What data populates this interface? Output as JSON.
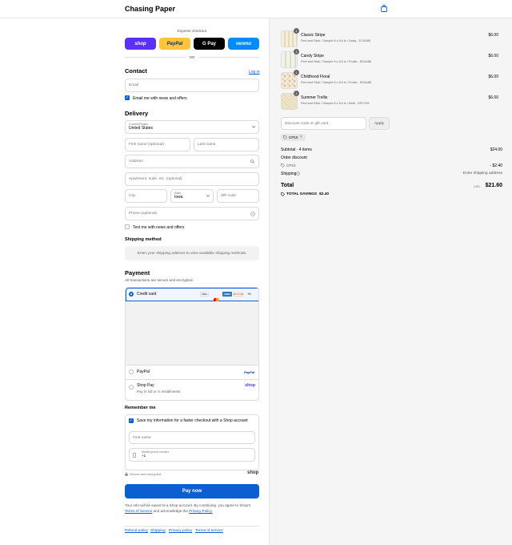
{
  "header": {
    "brand": "Chasing Paper",
    "cart_icon": "shopping-bag-icon"
  },
  "express": {
    "title": "Express checkout",
    "buttons": [
      "shop",
      "PayPal",
      "G Pay",
      "venmo"
    ],
    "colors": {
      "shop": "#5a31f4",
      "paypal": "#ffc439",
      "gpay": "#000000",
      "venmo": "#008cff"
    },
    "or": "OR"
  },
  "contact": {
    "title": "Contact",
    "login": "Log in",
    "email_placeholder": "Email",
    "news_label": "Email me with news and offers",
    "news_checked": true
  },
  "delivery": {
    "title": "Delivery",
    "country_label": "Country/Region",
    "country_value": "United States",
    "first_name": "First name (optional)",
    "last_name": "Last name",
    "address": "Address",
    "apartment": "Apartment, suite, etc. (optional)",
    "city": "City",
    "state_label": "State",
    "state_value": "Iowa",
    "zip": "ZIP code",
    "phone": "Phone (optional)",
    "text_label": "Text me with news and offers",
    "text_checked": false
  },
  "shipping": {
    "title": "Shipping method",
    "message": "Enter your shipping address to view available shipping methods."
  },
  "payment": {
    "title": "Payment",
    "subtitle": "All transactions are secure and encrypted.",
    "credit_card": "Credit card",
    "card_brands": [
      "VISA",
      "MC",
      "AMEX",
      "DISCOVER"
    ],
    "more_cards": "+5",
    "paypal": "PayPal",
    "paypal_logo": "PayPal",
    "shop_pay": "Shop Pay",
    "shop_pay_sub": "Pay in full or in installments",
    "shop_logo": "shop"
  },
  "remember": {
    "title": "Remember me",
    "save_label": "Save my information for a faster checkout with a Shop account",
    "first_name": "First name",
    "phone_label": "Mobile phone number",
    "phone_prefix": "+1",
    "secure": "Secure and encrypted",
    "shop_logo": "shop"
  },
  "pay_button": "Pay now",
  "legal": {
    "line1": "Your info will be saved to a Shop account. By continuing, you agree to Shop's",
    "tos": "Terms of Service",
    "and": "and acknowledge the",
    "privacy": "Privacy Policy."
  },
  "footer": {
    "links": [
      "Refund policy",
      "Shipping",
      "Privacy policy",
      "Terms of service"
    ]
  },
  "cart": {
    "items": [
      {
        "name": "Classic Stripe",
        "desc": "Peel and Stick / Sample 8 x 8.6 in / Daisy - ECA086",
        "price": "$6.00",
        "qty": "1"
      },
      {
        "name": "Candy Stripe",
        "desc": "Peel and Stick / Sample 8 x 8.6 in / Poolie - EDA488",
        "price": "$6.00",
        "qty": "1"
      },
      {
        "name": "Childhood Floral",
        "desc": "Peel and Stick / Sample 8 x 8.6 in / Poolie - EDA488",
        "price": "$6.00",
        "qty": "1"
      },
      {
        "name": "Summer Trellis",
        "desc": "Peel and Stick / Sample 8 x 8.6 in / Multi - EPC709",
        "price": "$6.00",
        "qty": "1"
      }
    ],
    "discount_placeholder": "Discount code or gift card",
    "apply": "Apply",
    "code_tag": "CP10",
    "subtotal_label": "Subtotal · 4 items",
    "subtotal_value": "$24.00",
    "order_discount_label": "Order discount",
    "discount_code": "CP10",
    "discount_value": "- $2.40",
    "shipping_label": "Shipping",
    "shipping_value": "Enter shipping address",
    "total_label": "Total",
    "currency": "USD",
    "total_value": "$21.60",
    "savings_label": "TOTAL SAVINGS",
    "savings_value": "$2.40"
  }
}
